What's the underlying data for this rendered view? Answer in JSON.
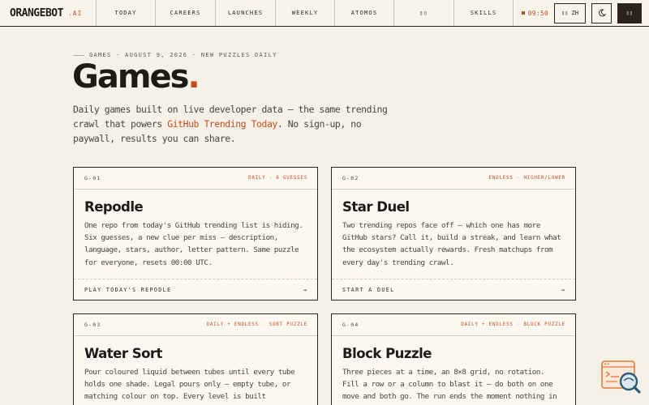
{
  "brand": {
    "name": "ORANGEBOT",
    "suffix": ".AI"
  },
  "nav": {
    "items": [
      "TODAY",
      "CAREERS",
      "LAUNCHES",
      "WEEKLY",
      "ATOMOS",
      "▯▯",
      "SKILLS"
    ],
    "clock": "09:50",
    "lang_label": "▯▯ ZH",
    "menu_label": "▯▯"
  },
  "hero": {
    "kicker": "GAMES · AUGUST 9, 2026 · NEW PUZZLES DAILY",
    "title": "Games",
    "title_dot": ".",
    "lede_before": "Daily games built on live developer data — the same trending crawl that powers ",
    "lede_link": "GitHub Trending Today",
    "lede_after": ". No sign-up, no paywall, results you can share."
  },
  "cards": [
    {
      "id": "G-01",
      "tag": "DAILY · 6 GUESSES",
      "title": "Repodle",
      "desc": "One repo from today's GitHub trending list is hiding. Six guesses, a new clue per miss — description, language, stars, author, letter pattern. Same puzzle for everyone, resets 00:00 UTC.",
      "cta": "PLAY TODAY'S REPODLE",
      "arrow": "→"
    },
    {
      "id": "G-02",
      "tag": "ENDLESS · HIGHER/LOWER",
      "title": "Star Duel",
      "desc": "Two trending repos face off — which one has more GitHub stars? Call it, build a streak, and learn what the ecosystem actually rewards. Fresh matchups from every day's trending crawl.",
      "cta": "START A DUEL",
      "arrow": "→"
    },
    {
      "id": "G-03",
      "tag": "DAILY + ENDLESS · SORT PUZZLE",
      "title": "Water Sort",
      "desc": "Pour coloured liquid between tubes until every tube holds one shade. Legal pours only — empty tube, or matching colour on top. Every level is built backwards from a solved"
    },
    {
      "id": "G-04",
      "tag": "DAILY + ENDLESS · BLOCK PUZZLE",
      "title": "Block Puzzle",
      "desc": "Three pieces at a time, an 8×8 grid, no rotation. Fill a row or a column to blast it — do both on one move and both go. The run ends the moment nothing in your tray fits. Daily"
    }
  ],
  "colors": {
    "accent": "#c24a20",
    "background": "#f6f1e7",
    "ink": "#1e1b16"
  },
  "icons": {
    "theme": "moon-icon",
    "assistant": "search-assistant-icon"
  }
}
